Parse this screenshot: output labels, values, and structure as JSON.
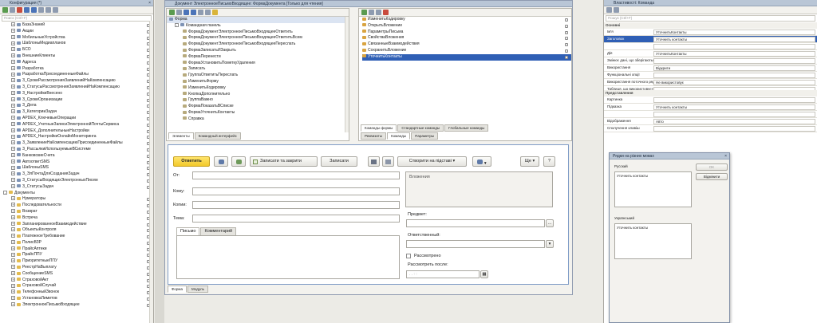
{
  "config": {
    "title": "Конфигурация (*)",
    "search_placeholder": "Поиск (Ctrl+F)",
    "items": [
      "БазаЗнаний",
      "Акции",
      "МобильныеУстройства",
      "ШаблоныМедиапланов",
      "БСО",
      "ВнешниеКлиенты",
      "Адреса",
      "Разработка",
      "РазработкаПрисоединенныеФайлы",
      "З_СрокиРассмотренияЗаявленийНаКомпенсацию",
      "З_СтатусыРассмотренияЗаявленийНаКомпенсацию",
      "З_НастройкиВнесено",
      "З_СрокиОрганизации",
      "З_Дела",
      "З_КатегорииЗадач",
      "APDEX_КлючевыеОперации",
      "APDEX_УчетныеЗаписиЭлектроннойПочтыСервиса",
      "APDEX_ДополнительныеНастройки",
      "APDEX_НастройкиОнлайнМониторинга",
      "З_ЗаявлениеНаКомпенсациюПрисоединенныеФайлы",
      "З_РассылкиИспользуемыеВСистеме",
      "БанковскиеСчета",
      "АвтоответSMS",
      "ШаблоныSMS",
      "З_ЭлПочтаДляСозданияЗадач",
      "З_СтатусыВходящихЭлектронныхПисем",
      "З_СтатусыЗадач"
    ],
    "documents_label": "Документы",
    "doc_items": [
      "Нумераторы",
      "Последовательности",
      "Возврат",
      "Встреча",
      "ЗапланированноеВзаимодействие",
      "ОбъектыКонтроля",
      "ПлатежноеТребование",
      "ПолисВЗР",
      "ПрайсАптеки",
      "ПрайсППУ",
      "ПриоритетныеППУ",
      "РеестрНаВыплату",
      "СообщениеSMS",
      "СтраховойАкт",
      "СтраховойСлучай",
      "ТелефонныйЗвонок",
      "УстановкаЛимитов",
      "ЭлектронноеПисьмоВходящее"
    ]
  },
  "doc_window": {
    "title": "Документ ЭлектронноеПисьмоВходящее: ФормаДокумента [Только для чтения]",
    "form_label": "Форма",
    "cmd_panel": "Командная панель",
    "elements": [
      "ФормаДокументЭлектронноеПисьмоВходящееОтветить",
      "ФормаДокументЭлектронноеПисьмоВходящееОтветитьВсем",
      "ФормаДокументЭлектронноеПисьмоВходящееПереслать",
      "ФормаЗаписатьИЗакрыть",
      "ФормаПеренести",
      "ФормаУстановитьПометкуУдаления",
      "Записать",
      "ГруппаОтветитьПереслать",
      "ИзменитьФорму",
      "ИзменитьКодировку",
      "КнопкаДополнительно",
      "ГруппаВажно",
      "ФормаПоказатьВСписке",
      "ФормаУточнитьКонтакты",
      "Справка"
    ],
    "left_tabs": [
      "Элементы",
      "Командный интерфейс"
    ],
    "commands": [
      "ИзменитьКодировку",
      "ОткрытьВложение",
      "ПараметрыПисьма",
      "СвойстваВложения",
      "СвязанныеВзаимодействия",
      "СохранитьВложение",
      "УточнитьКонтакты"
    ],
    "cmd_tabs_top": [
      "Команды формы",
      "Стандартные команды",
      "Глобальные команды"
    ],
    "cmd_tabs_bottom": [
      "Реквизиты",
      "Команды",
      "Параметры"
    ]
  },
  "preview": {
    "reply_button": "Ответить",
    "save_close": "Записати та закрити",
    "save": "Записати",
    "create_based": "Створити на підставі",
    "more": "Ще",
    "help": "?",
    "from_label": "От:",
    "to_label": "Кому:",
    "cc_label": "Копии:",
    "subject_label": "Тема:",
    "attachments_label": "Вложения",
    "subject_field_label": "Предмет:",
    "responsible_label": "Ответственный:",
    "reviewed_label": "Рассмотрено",
    "review_after_label": "Рассмотреть после:",
    "date_placeholder": ". .   : :",
    "tabs": [
      "Письмо",
      "Комментарий"
    ],
    "bottom_tabs": [
      "Форма",
      "Модуль"
    ]
  },
  "properties": {
    "title": "Властивості: Команда",
    "search_placeholder": "Пошук (Ctrl+F)",
    "section_main": "Основні",
    "rows": [
      {
        "k": "Ім'я",
        "v": "УточнитьКонтакты"
      },
      {
        "k": "Заголовок",
        "v": "Уточнить контакты"
      },
      {
        "k": "",
        "v": ""
      },
      {
        "k": "Дія",
        "v": "УточнитьКонтакты"
      },
      {
        "k": "Змінює дані, що зберігаються",
        "v": ""
      },
      {
        "k": "Використання",
        "v": "Відкрити"
      },
      {
        "k": "Функціональні опції",
        "v": ""
      },
      {
        "k": "Використання поточного рядка",
        "v": "Не використовує"
      },
      {
        "k": "Таблиця, що використовується",
        "v": ""
      }
    ],
    "section_view": "Представлення",
    "view_rows": [
      {
        "k": "Картинка",
        "v": ""
      },
      {
        "k": "Підказка",
        "v": "Уточнить контакты"
      },
      {
        "k": "",
        "v": ""
      },
      {
        "k": "Відображення",
        "v": "Авто"
      },
      {
        "k": "Сполучення клавіш",
        "v": ""
      }
    ]
  },
  "lang_dialog": {
    "title": "Рядки на різних мовах",
    "ok_button": "OK",
    "cancel_button": "Відмінити",
    "russian_label": "Русский",
    "russian_value": "Уточнить контакты",
    "ukrainian_label": "Український",
    "ukrainian_value": "Уточнить контакты"
  }
}
